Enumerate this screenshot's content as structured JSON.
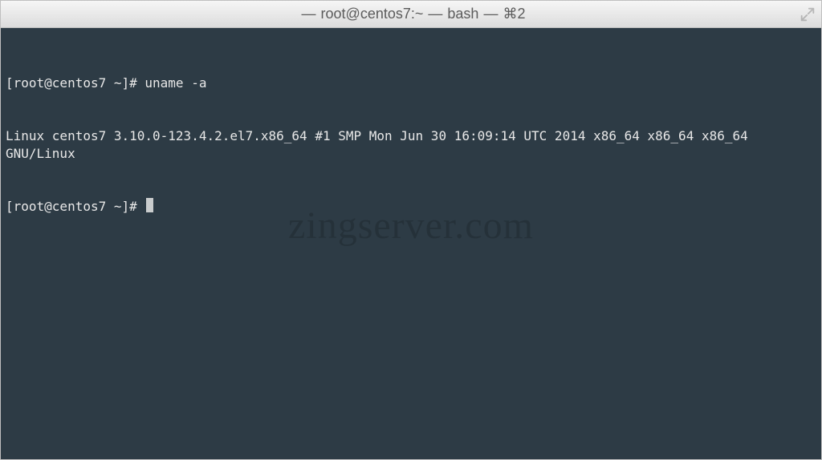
{
  "titlebar": {
    "folder": "~",
    "user_host": "root@centos7",
    "shell": "bash",
    "shortcut_glyph": "⌘",
    "shortcut_num": "2"
  },
  "terminal": {
    "prompt_open": "[root@centos7 ~]# ",
    "lines": {
      "l0": "uname -a",
      "l1": "Linux centos7 3.10.0-123.4.2.el7.x86_64 #1 SMP Mon Jun 30 16:09:14 UTC 2014 x86_64 x86_64 x86_64 GNU/Linux"
    }
  },
  "watermark": "zingserver.com",
  "colors": {
    "term_bg": "#2d3b45",
    "term_fg": "#e8e8e8"
  }
}
